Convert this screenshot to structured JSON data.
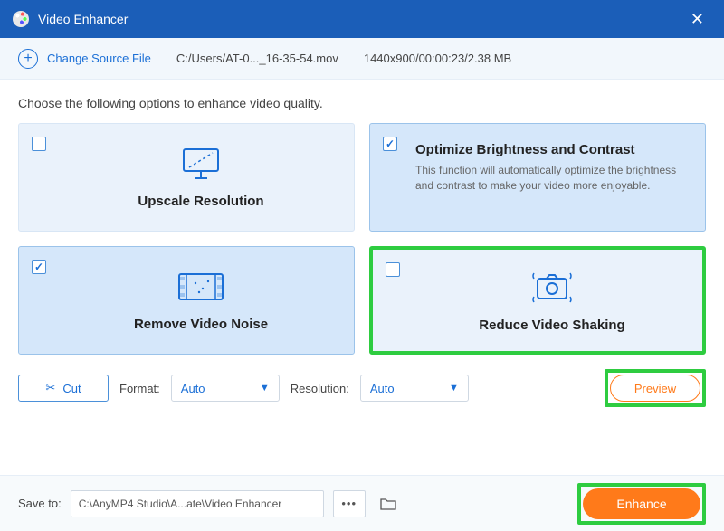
{
  "window": {
    "title": "Video Enhancer"
  },
  "source": {
    "change_label": "Change Source File",
    "path": "C:/Users/AT-0..._16-35-54.mov",
    "info": "1440x900/00:00:23/2.38 MB"
  },
  "instruction": "Choose the following options to enhance video quality.",
  "cards": {
    "upscale": {
      "title": "Upscale Resolution",
      "checked": false
    },
    "brightness": {
      "title": "Optimize Brightness and Contrast",
      "desc": "This function will automatically optimize the brightness and contrast to make your video more enjoyable.",
      "checked": true
    },
    "noise": {
      "title": "Remove Video Noise",
      "checked": true
    },
    "shaking": {
      "title": "Reduce Video Shaking",
      "checked": false,
      "highlighted": true
    }
  },
  "toolbar": {
    "cut_label": "Cut",
    "format_label": "Format:",
    "format_value": "Auto",
    "resolution_label": "Resolution:",
    "resolution_value": "Auto",
    "preview_label": "Preview"
  },
  "footer": {
    "save_label": "Save to:",
    "save_path": "C:\\AnyMP4 Studio\\A...ate\\Video Enhancer",
    "enhance_label": "Enhance"
  }
}
